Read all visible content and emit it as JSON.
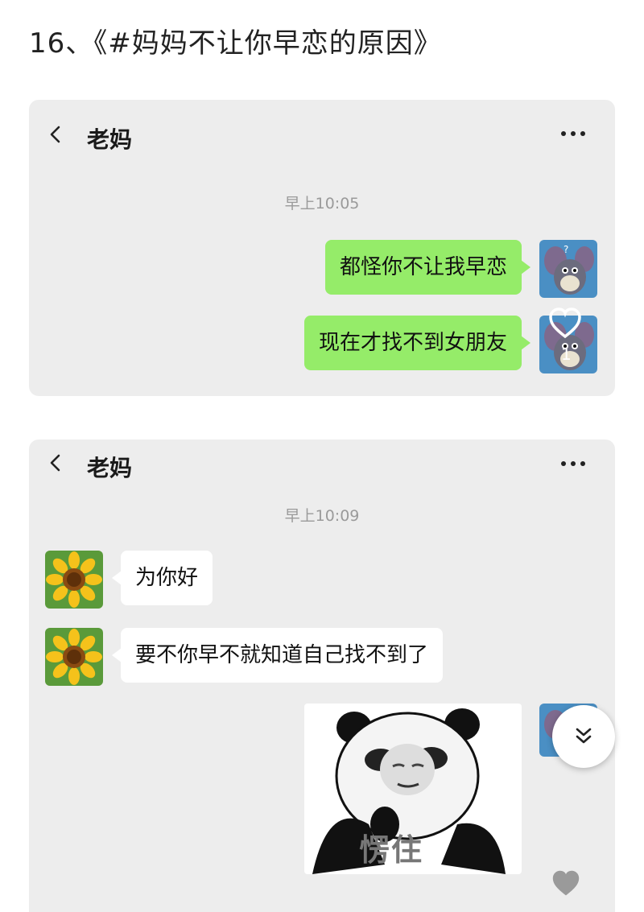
{
  "page": {
    "title": "16、《#妈妈不让你早恋的原因》"
  },
  "chat1": {
    "contact_name": "老妈",
    "timestamp": "早上10:05",
    "messages": [
      {
        "side": "me",
        "text": "都怪你不让我早恋"
      },
      {
        "side": "me",
        "text": "现在才找不到女朋友"
      }
    ],
    "like_count": "1"
  },
  "chat2": {
    "contact_name": "老妈",
    "timestamp": "早上10:09",
    "messages": [
      {
        "side": "other",
        "text": "为你好"
      },
      {
        "side": "other",
        "text": "要不你早不就知道自己找不到了"
      }
    ],
    "sticker_caption": "愣住"
  },
  "icons": {
    "back": "chevron-left-icon",
    "more": "more-dots-icon",
    "heart": "heart-icon",
    "scroll_down": "double-chevron-down-icon"
  },
  "colors": {
    "my_bubble": "#95ec69",
    "other_bubble": "#ffffff",
    "chat_background": "#ededed"
  }
}
